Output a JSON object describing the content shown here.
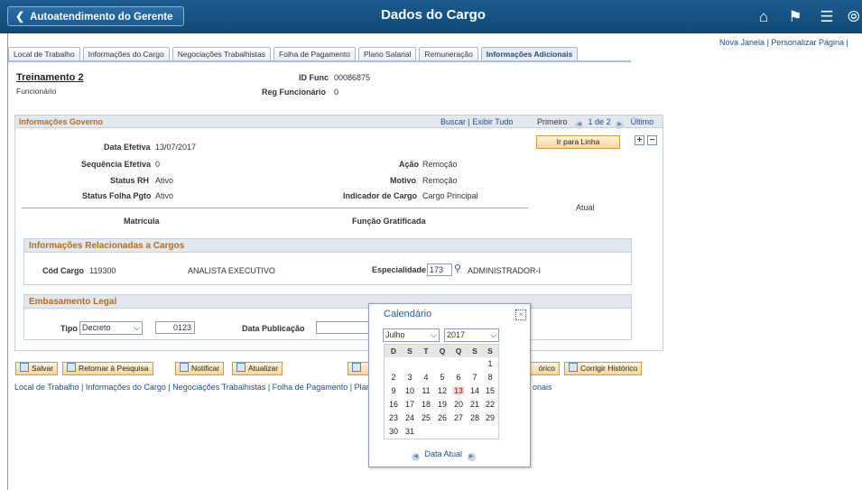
{
  "header": {
    "back_label": "Autoatendimento do Gerente",
    "title": "Dados do Cargo",
    "icons": [
      "home-icon",
      "flag-icon",
      "menu-icon",
      "compass-icon"
    ]
  },
  "top_links": {
    "new_window": "Nova Janela",
    "personalize": "Personalizar Página",
    "separator": "|"
  },
  "tabs": [
    {
      "label": "Local de Trabalho"
    },
    {
      "label": "Informações do Cargo"
    },
    {
      "label": "Negociações Trabalhistas"
    },
    {
      "label": "Folha de Pagamento"
    },
    {
      "label": "Plano Salarial"
    },
    {
      "label": "Remuneração"
    },
    {
      "label": "Informações Adicionais"
    }
  ],
  "employee": {
    "name": "Treinamento 2",
    "type": "Funcionário",
    "id_label": "ID Func",
    "id_value": "00086875",
    "reg_label": "Reg Funcionário",
    "reg_value": "0"
  },
  "gov_section": {
    "title": "Informações Governo",
    "find": "Buscar",
    "view_all": "Exibir Tudo",
    "first": "Primeiro",
    "pager": "1 de 2",
    "last": "Último",
    "goto_row": "Ir para Linha",
    "add": "+",
    "remove": "−",
    "fields": {
      "data_efetiva_label": "Data Efetiva",
      "data_efetiva": "13/07/2017",
      "seq_label": "Sequência Efetiva",
      "seq": "0",
      "status_rh_label": "Status RH",
      "status_rh": "Ativo",
      "status_folha_label": "Status Folha Pgto",
      "status_folha": "Ativo",
      "acao_label": "Ação",
      "acao": "Remoção",
      "motivo_label": "Motivo",
      "motivo": "Remoção",
      "indicador_label": "Indicador de Cargo",
      "indicador": "Cargo Principal",
      "atual": "Atual",
      "matricula_label": "Matrícula",
      "funcao_label": "Função Gratificada"
    }
  },
  "cargo_section": {
    "title": "Informações Relacionadas a Cargos",
    "cod_label": "Cód Cargo",
    "cod": "119300",
    "desc": "ANALISTA EXECUTIVO",
    "espec_label": "Especialidade",
    "espec": "173",
    "espec_desc": "ADMINISTRADOR-I"
  },
  "legal_section": {
    "title": "Embasamento Legal",
    "tipo_label": "Tipo",
    "tipo": "Decreto",
    "numero": "0123",
    "data_pub_label": "Data Publicação",
    "data_pub": ""
  },
  "toolbar": {
    "save": "Salvar",
    "return": "Retornar à Pesquisa",
    "notify": "Notificar",
    "refresh": "Atualizar",
    "history_partial": "órico",
    "correct_history": "Corrigir Histórico"
  },
  "bottom_links": {
    "left": "Local de Trabalho | Informações do Cargo | Negociações Trabalhistas | Folha de Pagamento | Plar",
    "right": "onais"
  },
  "calendar": {
    "title": "Calendário",
    "close": "×",
    "month": "Julho",
    "year": "2017",
    "dow": [
      "D",
      "S",
      "T",
      "Q",
      "Q",
      "S",
      "S"
    ],
    "weeks": [
      [
        "",
        "",
        "",
        "",
        "",
        "",
        "1"
      ],
      [
        "2",
        "3",
        "4",
        "5",
        "6",
        "7",
        "8"
      ],
      [
        "9",
        "10",
        "11",
        "12",
        "13",
        "14",
        "15"
      ],
      [
        "16",
        "17",
        "18",
        "19",
        "20",
        "21",
        "22"
      ],
      [
        "23",
        "24",
        "25",
        "26",
        "27",
        "28",
        "29"
      ],
      [
        "30",
        "31",
        "",
        "",
        "",
        "",
        ""
      ]
    ],
    "today": "13",
    "current_date": "Data Atual"
  }
}
